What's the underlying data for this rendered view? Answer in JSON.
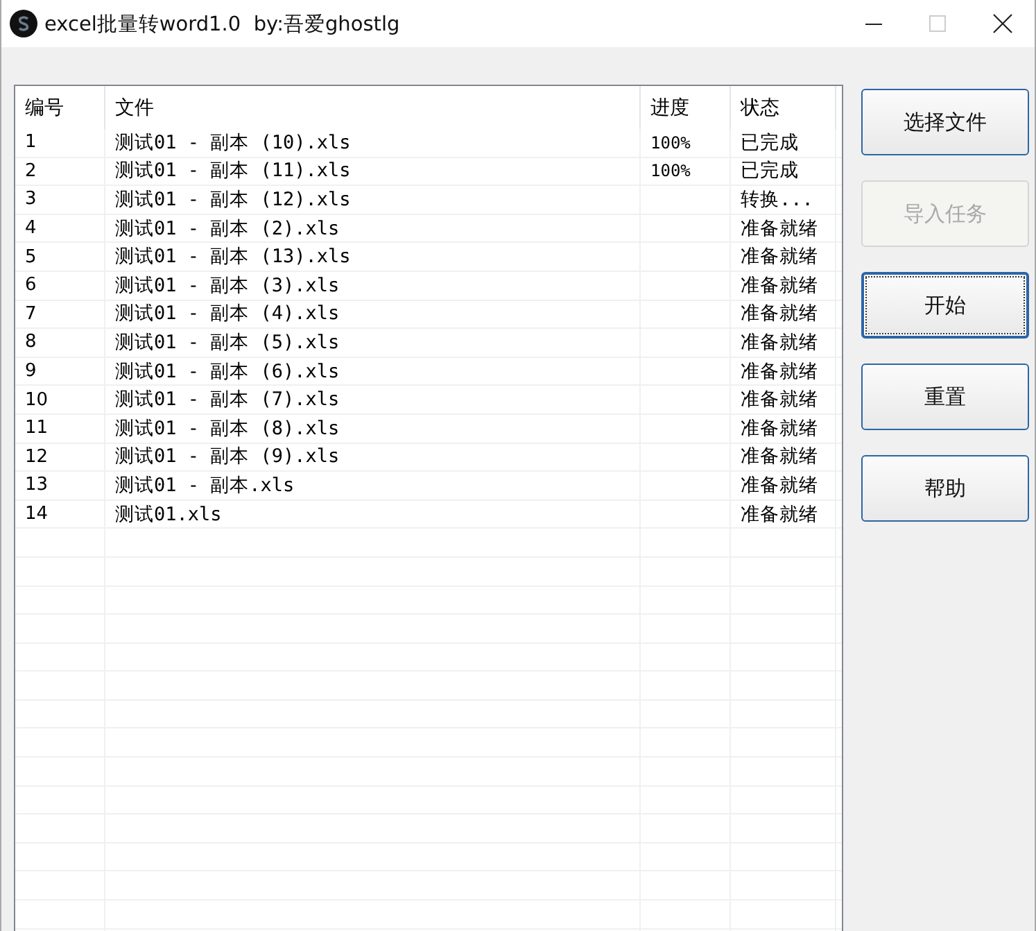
{
  "window": {
    "title": "excel批量转word1.0  by:吾爱ghostlg"
  },
  "table": {
    "columns": [
      "编号",
      "文件",
      "进度",
      "状态"
    ],
    "rows": [
      {
        "cells": [
          "1",
          "测试01 - 副本 (10).xls",
          "100%",
          "已完成"
        ]
      },
      {
        "cells": [
          "2",
          "测试01 - 副本 (11).xls",
          "100%",
          "已完成"
        ]
      },
      {
        "cells": [
          "3",
          "测试01 - 副本 (12).xls",
          "",
          "转换..."
        ]
      },
      {
        "cells": [
          "4",
          "测试01 - 副本 (2).xls",
          "",
          "准备就绪"
        ]
      },
      {
        "cells": [
          "5",
          "测试01 - 副本 (13).xls",
          "",
          "准备就绪"
        ]
      },
      {
        "cells": [
          "6",
          "测试01 - 副本 (3).xls",
          "",
          "准备就绪"
        ]
      },
      {
        "cells": [
          "7",
          "测试01 - 副本 (4).xls",
          "",
          "准备就绪"
        ]
      },
      {
        "cells": [
          "8",
          "测试01 - 副本 (5).xls",
          "",
          "准备就绪"
        ]
      },
      {
        "cells": [
          "9",
          "测试01 - 副本 (6).xls",
          "",
          "准备就绪"
        ]
      },
      {
        "cells": [
          "10",
          "测试01 - 副本 (7).xls",
          "",
          "准备就绪"
        ]
      },
      {
        "cells": [
          "11",
          "测试01 - 副本 (8).xls",
          "",
          "准备就绪"
        ]
      },
      {
        "cells": [
          "12",
          "测试01 - 副本 (9).xls",
          "",
          "准备就绪"
        ]
      },
      {
        "cells": [
          "13",
          "测试01 - 副本.xls",
          "",
          "准备就绪"
        ]
      },
      {
        "cells": [
          "14",
          "测试01.xls",
          "",
          "准备就绪"
        ]
      }
    ]
  },
  "buttons": [
    {
      "label": "选择文件",
      "disabled": false,
      "focused": false
    },
    {
      "label": "导入任务",
      "disabled": true,
      "focused": false
    },
    {
      "label": "开始",
      "disabled": false,
      "focused": true
    },
    {
      "label": "重置",
      "disabled": false,
      "focused": false
    },
    {
      "label": "帮助",
      "disabled": false,
      "focused": false
    }
  ]
}
